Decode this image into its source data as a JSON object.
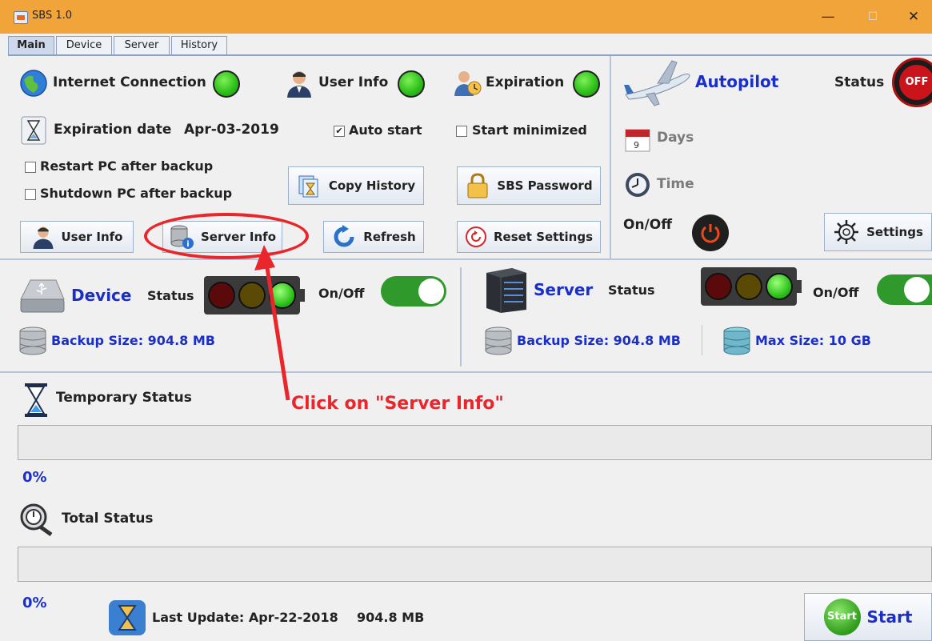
{
  "window": {
    "title": "SBS 1.0",
    "minimize": "—",
    "maximize": "☐",
    "close": "✕"
  },
  "tabs": [
    "Main",
    "Device",
    "Server",
    "History"
  ],
  "top": {
    "internet_connection": "Internet Connection",
    "user_info_label": "User Info",
    "expiration_label": "Expiration",
    "expiration_date_label": "Expiration date",
    "expiration_date_value": "Apr-03-2019",
    "auto_start": {
      "label": "Auto start",
      "checked": true,
      "mark": "✔"
    },
    "start_minimized": {
      "label": "Start minimized",
      "checked": false
    },
    "restart_pc": {
      "label": "Restart PC after backup",
      "checked": false
    },
    "shutdown_pc": {
      "label": "Shutdown PC after backup",
      "checked": false
    },
    "buttons": {
      "copy_history": "Copy History",
      "sbs_password": "SBS Password",
      "user_info": "User Info",
      "server_info": "Server Info",
      "refresh": "Refresh",
      "reset_settings": "Reset Settings"
    }
  },
  "autopilot": {
    "title": "Autopilot",
    "status_label": "Status",
    "status_badge": "OFF",
    "days": "Days",
    "time": "Time",
    "onoff": "On/Off",
    "settings": "Settings"
  },
  "device": {
    "title": "Device",
    "status_label": "Status",
    "onoff": "On/Off",
    "backup_size": "Backup Size:  904.8 MB"
  },
  "server": {
    "title": "Server",
    "status_label": "Status",
    "onoff": "On/Off",
    "backup_size": "Backup Size:  904.8 MB",
    "max_size": "Max Size: 10 GB"
  },
  "temporary_status": {
    "label": "Temporary Status",
    "percent": "0%"
  },
  "total_status": {
    "label": "Total Status",
    "percent": "0%"
  },
  "footer": {
    "last_update": "Last Update: Apr-22-2018",
    "size": "904.8 MB",
    "start_button": "Start",
    "start_badge": "Start"
  },
  "annotation": {
    "text": "Click on \"Server Info\""
  },
  "colors": {
    "accent_orange": "#f0a43a",
    "label_blue": "#1b2fc7",
    "annotation_red": "#e8262b",
    "led_green": "#2fc21b"
  }
}
